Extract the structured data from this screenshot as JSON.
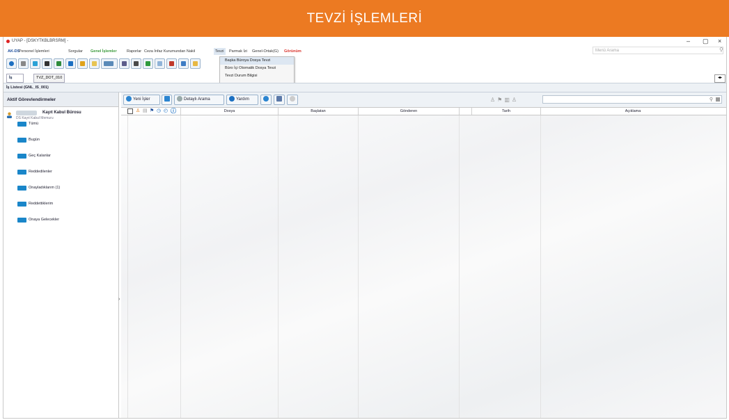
{
  "banner": {
    "title": "TEVZİ İŞLEMLERİ"
  },
  "window": {
    "title": "UYAP - [DSKYTKBLBRSRM] -",
    "minimize": "–",
    "restore": "▢",
    "close": "×"
  },
  "menu": {
    "items": [
      "AK-DS",
      "Personel İşlemleri",
      "Sorgular",
      "Genel İşlemler",
      "Raporlar",
      "Ceza İnfaz Kurumundan Nakil",
      "Tevzi",
      "Parmak İzi",
      "Genel-Ortak(G)",
      "Görünüm"
    ],
    "search_placeholder": "Menü Arama"
  },
  "dropdown": {
    "items": [
      "Başka Büroya Dosya Tevzi",
      "Büro İçi Otomatik Dosya Tevzi",
      "Tevzi Durum Bilgisi"
    ]
  },
  "tabs": [
    "İş Listesi",
    "TVZ_DOT_010"
  ],
  "breadcrumb": "İş Listesi (GNL_IS_001)",
  "left": {
    "header": "Aktif Görevlendirmeler",
    "office_name": "Kayıt Kabul Bürosu",
    "office_sub": "DS Kayıt Kabul Memuru",
    "folders": [
      "Tümü",
      "Bugün",
      "Geç Kalanlar",
      "Reddedilenler",
      "Onayladıklarım (1)",
      "Reddettiklerim",
      "Onaya Gelecekler"
    ]
  },
  "toolbar": {
    "new_jobs": "Yeni İşler",
    "detail_search": "Detaylı Arama",
    "help": "Yardım"
  },
  "table": {
    "headers": [
      "Dosya",
      "Başlatan",
      "Gönderen",
      "Tarih",
      "Açıklama"
    ]
  },
  "colors": {
    "banner": "#ec7a22",
    "folder": "#1a86c9",
    "menu_green": "#3b9a3b",
    "menu_red": "#d9322b"
  }
}
